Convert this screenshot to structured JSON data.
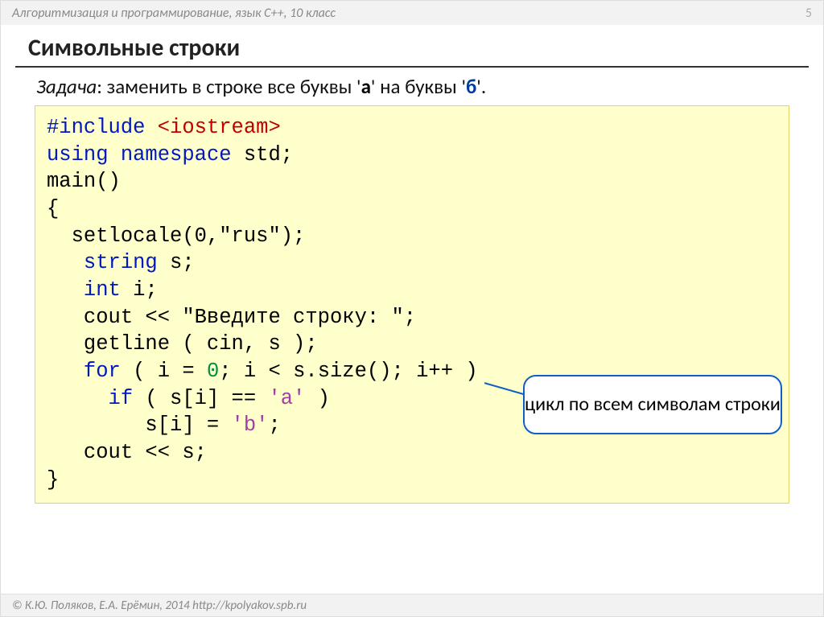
{
  "header": {
    "course": "Алгоритмизация и программирование, язык С++, 10 класс",
    "page": "5"
  },
  "title": "Символьные строки",
  "task": {
    "label": "Задача",
    "sep": ": ",
    "pre": "заменить в строке все буквы ",
    "q1": "'",
    "a": "а",
    "q2": "'",
    "mid": " на буквы ",
    "q3": "'",
    "b": "б",
    "q4": "'",
    "end": "."
  },
  "code": {
    "l01a": "#include ",
    "l01b": "<iostream>",
    "l02a": "using",
    "l02b": " ",
    "l02c": "namespace",
    "l02d": " std;",
    "l03": "main()",
    "l04": "{",
    "l05": "  setlocale(0,\"rus\");",
    "l06a": "   ",
    "l06b": "string",
    "l06c": " s;",
    "l07a": "   ",
    "l07b": "int",
    "l07c": " i;",
    "l08a": "   cout << ",
    "l08b": "\"Введите строку: \"",
    "l08c": ";",
    "l09": "   getline ( cin, s );",
    "l10a": "   ",
    "l10b": "for",
    "l10c": " ( i = ",
    "l10d": "0",
    "l10e": "; i < s.size(); i++ )",
    "l11a": "     ",
    "l11b": "if",
    "l11c": " ( s[i] == ",
    "l11d": "'a'",
    "l11e": " )",
    "l12a": "        s[i] = ",
    "l12b": "'b'",
    "l12c": ";",
    "l13": "   cout << s;",
    "l14": "}"
  },
  "callout": "цикл по всем символам строки",
  "footer": "© К.Ю. Поляков, Е.А. Ерёмин, 2014   http://kpolyakov.spb.ru"
}
